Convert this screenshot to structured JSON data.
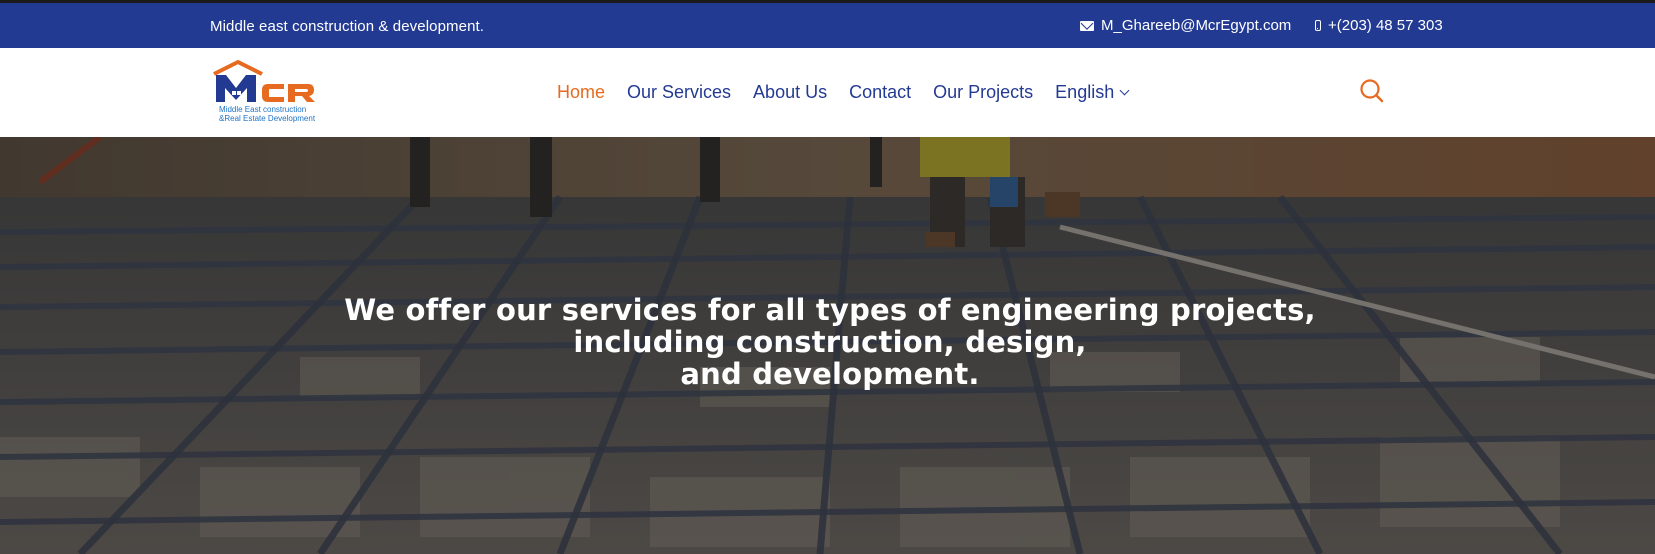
{
  "topbar": {
    "tagline": "Middle east construction & development.",
    "email": "M_Ghareeb@McrEgypt.com",
    "phone": "+(203) 48 57 303"
  },
  "logo": {
    "letters": "MCR",
    "subtitle_line1": "Middle East construction",
    "subtitle_line2": "&Real Estate Development"
  },
  "nav": {
    "items": [
      {
        "label": "Home",
        "active": true
      },
      {
        "label": "Our Services",
        "active": false
      },
      {
        "label": "About Us",
        "active": false
      },
      {
        "label": "Contact",
        "active": false
      },
      {
        "label": "Our Projects",
        "active": false
      }
    ],
    "language": "English"
  },
  "hero": {
    "line1": "We offer our services for all types of engineering projects,",
    "line2": "including construction, design,",
    "line3": "and development."
  },
  "colors": {
    "primary": "#233a93",
    "accent": "#e66a1f"
  },
  "icons": {
    "email": "mail-icon",
    "phone": "phone-icon",
    "search": "search-icon",
    "language": "chevron-down-icon"
  }
}
